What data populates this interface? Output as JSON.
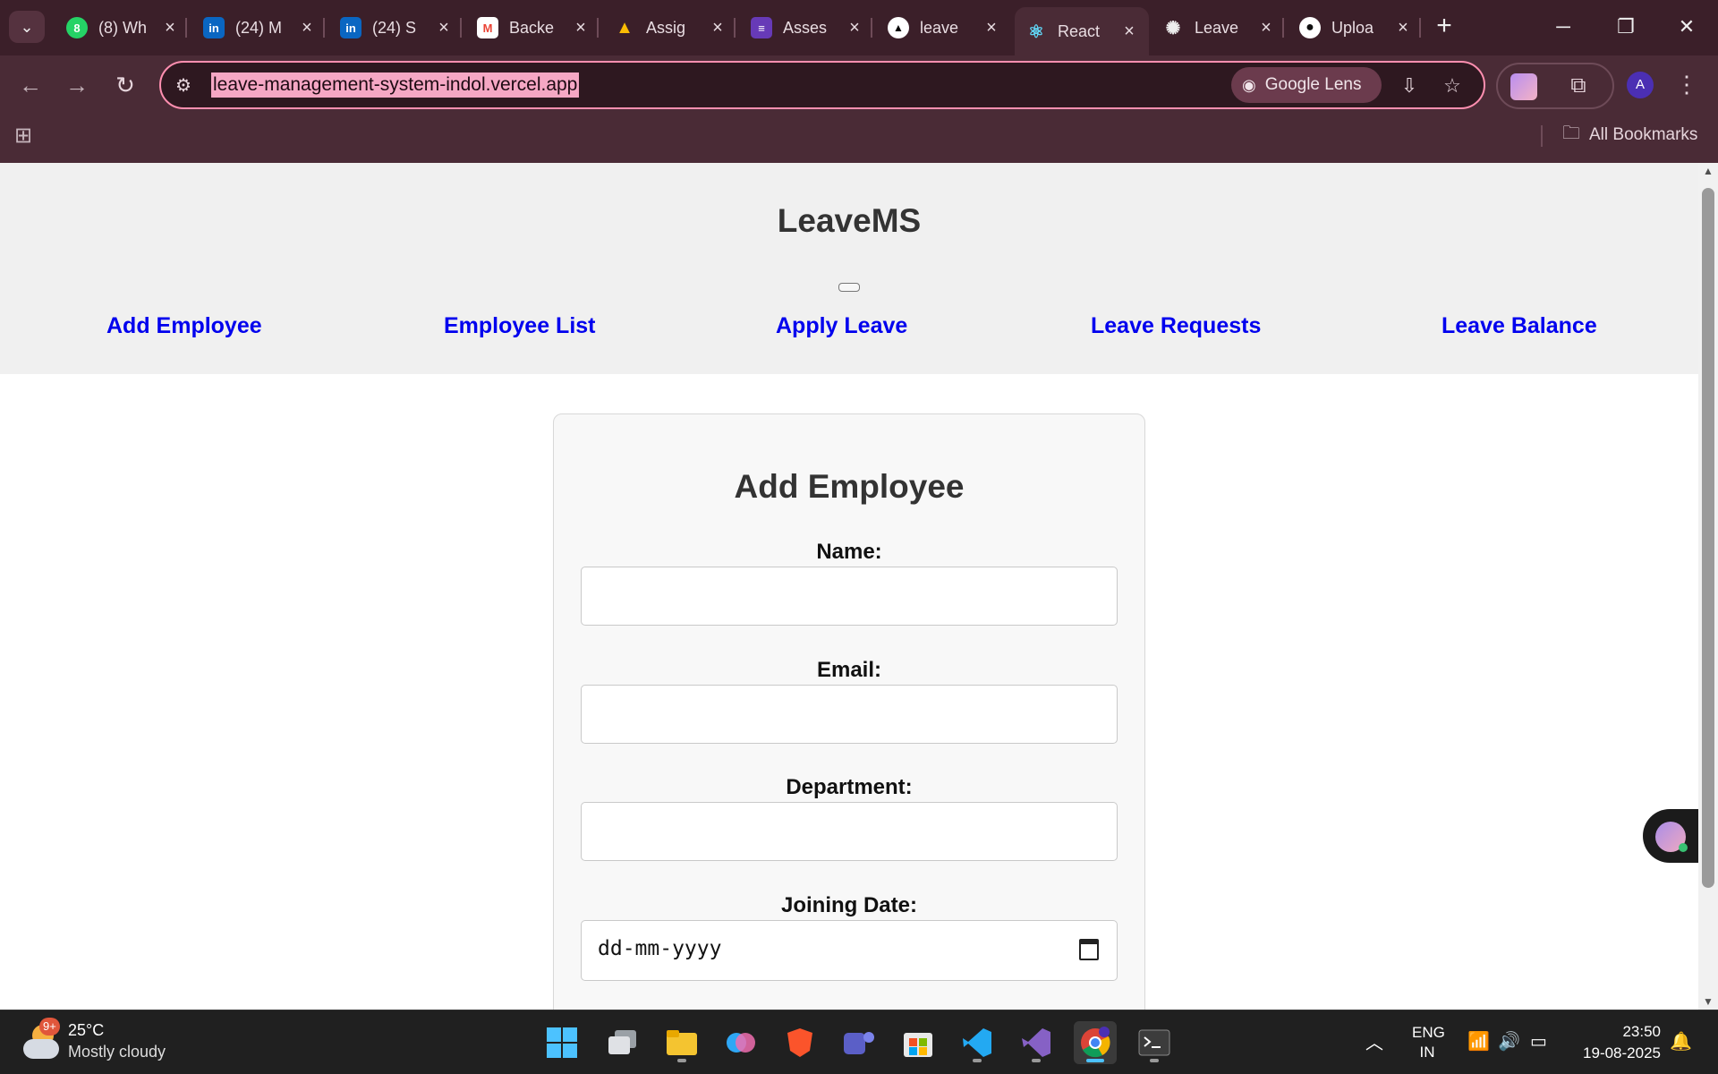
{
  "browser": {
    "tabs": [
      {
        "label": "(8) Wh",
        "icon": "whatsapp-icon",
        "color": "#25d366",
        "glyph": "8"
      },
      {
        "label": "(24) M",
        "icon": "linkedin-icon",
        "color": "#0a66c2",
        "glyph": "in"
      },
      {
        "label": "(24) S",
        "icon": "linkedin-icon",
        "color": "#0a66c2",
        "glyph": "in"
      },
      {
        "label": "Backe",
        "icon": "gmail-icon",
        "color": "#ea4335",
        "glyph": "M"
      },
      {
        "label": "Assig",
        "icon": "google-drive-icon",
        "color": "#34a853",
        "glyph": "▲"
      },
      {
        "label": "Asses",
        "icon": "forms-icon",
        "color": "#673ab7",
        "glyph": "≡"
      },
      {
        "label": "leave",
        "icon": "vercel-icon",
        "color": "#000000",
        "glyph": "▲"
      },
      {
        "label": "React",
        "icon": "react-icon",
        "color": "#3b1f29",
        "glyph": "⚛",
        "active": true
      },
      {
        "label": "Leave",
        "icon": "chatgpt-icon",
        "color": "#3b1f29",
        "glyph": "✺"
      },
      {
        "label": "Uploa",
        "icon": "github-icon",
        "color": "#3b1f29",
        "glyph": "●"
      }
    ],
    "url": "leave-management-system-indol.vercel.app",
    "lens_label": "Google Lens",
    "profile_initial": "A",
    "all_bookmarks": "All Bookmarks"
  },
  "page": {
    "brand": "LeaveMS",
    "nav": [
      "Add Employee",
      "Employee List",
      "Apply Leave",
      "Leave Requests",
      "Leave Balance"
    ],
    "form": {
      "title": "Add Employee",
      "name_label": "Name:",
      "email_label": "Email:",
      "department_label": "Department:",
      "joining_label": "Joining Date:",
      "date_placeholder": "dd-mm-yyyy"
    }
  },
  "taskbar": {
    "weather_badge": "9+",
    "temperature": "25°C",
    "condition": "Mostly cloudy",
    "lang_top": "ENG",
    "lang_bottom": "IN",
    "time": "23:50",
    "date": "19-08-2025"
  },
  "colors": {
    "accent_link": "#0000ee",
    "omnibox_border": "#ff8fb0",
    "url_highlight": "#f5a7c4"
  }
}
